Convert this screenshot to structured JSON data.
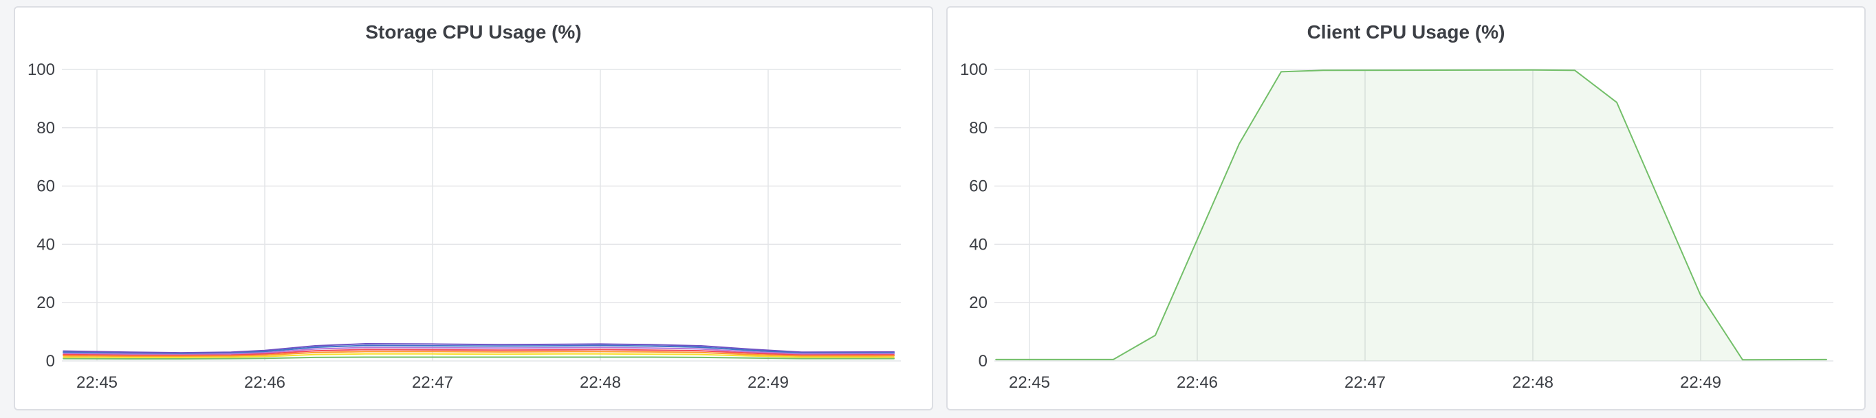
{
  "panels": [
    {
      "title": "Storage CPU Usage (%)"
    },
    {
      "title": "Client CPU Usage (%)"
    }
  ],
  "chart_data": [
    {
      "type": "line",
      "title": "Storage CPU Usage (%)",
      "ylim": [
        0,
        100
      ],
      "yticks": [
        "0",
        "20",
        "40",
        "60",
        "80",
        "100"
      ],
      "xticks": [
        "22:45",
        "22:46",
        "22:47",
        "22:48",
        "22:49"
      ],
      "xtick_minutes": [
        0,
        1,
        2,
        3,
        4
      ],
      "grid": true,
      "x_minutes": [
        -0.2,
        0.2,
        0.5,
        0.8,
        1.0,
        1.3,
        1.6,
        2.0,
        2.4,
        2.8,
        3.0,
        3.3,
        3.6,
        3.9,
        4.2,
        4.75
      ],
      "series": [
        {
          "color": "#6f52c4",
          "values": [
            3.4,
            3.0,
            2.8,
            3.0,
            3.6,
            5.2,
            5.9,
            5.8,
            5.6,
            5.7,
            5.8,
            5.6,
            5.2,
            4.0,
            3.0,
            3.1
          ]
        },
        {
          "color": "#3f74c8",
          "values": [
            3.0,
            2.6,
            2.5,
            2.7,
            3.2,
            4.7,
            5.3,
            5.2,
            5.1,
            5.2,
            5.3,
            5.1,
            4.7,
            3.6,
            2.7,
            2.8
          ]
        },
        {
          "color": "#b877d9",
          "values": [
            2.6,
            2.3,
            2.2,
            2.4,
            2.8,
            4.1,
            4.6,
            4.5,
            4.4,
            4.5,
            4.6,
            4.4,
            4.1,
            3.1,
            2.4,
            2.5
          ]
        },
        {
          "color": "#f2495c",
          "values": [
            2.2,
            1.9,
            1.9,
            2.0,
            2.4,
            3.5,
            3.9,
            3.8,
            3.7,
            3.8,
            3.9,
            3.7,
            3.5,
            2.7,
            2.0,
            2.1
          ]
        },
        {
          "color": "#ff9830",
          "values": [
            1.8,
            1.6,
            1.6,
            1.7,
            2.0,
            2.9,
            3.2,
            3.2,
            3.1,
            3.2,
            3.2,
            3.1,
            2.9,
            2.2,
            1.7,
            1.8
          ]
        },
        {
          "color": "#fade2a",
          "values": [
            1.3,
            1.2,
            1.2,
            1.3,
            1.5,
            2.2,
            2.4,
            2.4,
            2.3,
            2.4,
            2.4,
            2.3,
            2.2,
            1.7,
            1.3,
            1.3
          ]
        },
        {
          "color": "#73bf69",
          "values": [
            0.8,
            0.7,
            0.7,
            0.8,
            0.9,
            1.2,
            1.3,
            1.3,
            1.3,
            1.3,
            1.3,
            1.3,
            1.2,
            1.0,
            0.8,
            0.8
          ]
        }
      ]
    },
    {
      "type": "area",
      "title": "Client CPU Usage (%)",
      "ylim": [
        0,
        100
      ],
      "yticks": [
        "0",
        "20",
        "40",
        "60",
        "80",
        "100"
      ],
      "xticks": [
        "22:45",
        "22:46",
        "22:47",
        "22:48",
        "22:49"
      ],
      "xtick_minutes": [
        0,
        1,
        2,
        3,
        4
      ],
      "grid": true,
      "x_minutes": [
        -0.2,
        0.5,
        0.75,
        1.25,
        1.5,
        1.75,
        3.0,
        3.25,
        3.5,
        4.0,
        4.25,
        4.75
      ],
      "series": [
        {
          "color": "#73bf69",
          "values": [
            0.5,
            0.5,
            8.8,
            74.5,
            99.2,
            99.7,
            99.8,
            99.7,
            88.7,
            22.5,
            0.4,
            0.5
          ]
        }
      ]
    }
  ]
}
